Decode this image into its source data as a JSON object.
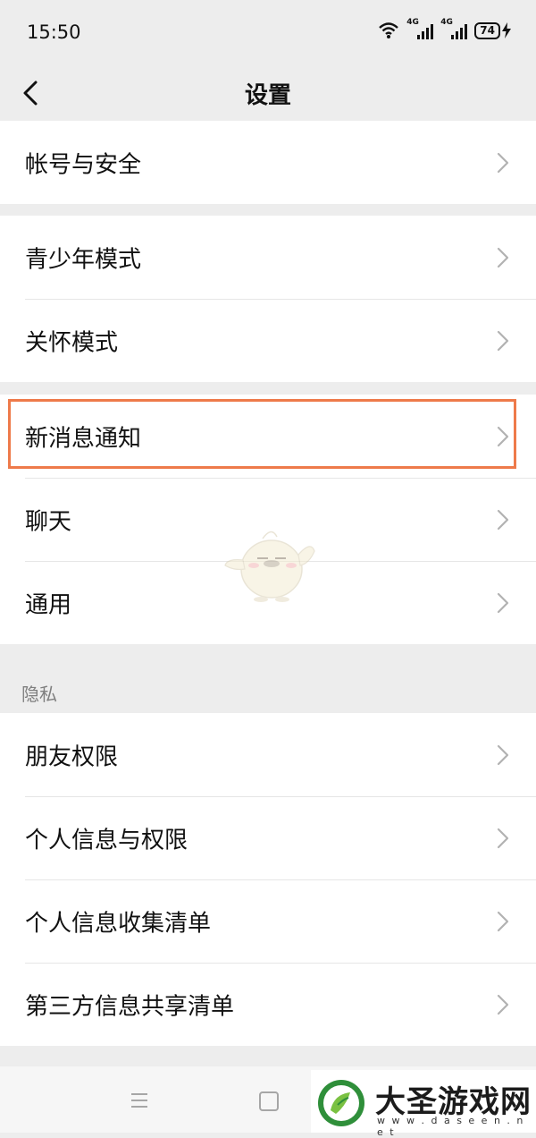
{
  "status_bar": {
    "time": "15:50",
    "signal_1_tag": "4G",
    "signal_2_tag": "4G",
    "battery_level": "74"
  },
  "header": {
    "title": "设置"
  },
  "groups": [
    {
      "items": [
        {
          "label": "帐号与安全"
        }
      ]
    },
    {
      "items": [
        {
          "label": "青少年模式"
        },
        {
          "label": "关怀模式"
        }
      ]
    },
    {
      "items": [
        {
          "label": "新消息通知",
          "highlighted": true
        },
        {
          "label": "聊天"
        },
        {
          "label": "通用"
        }
      ]
    }
  ],
  "privacy": {
    "section_label": "隐私",
    "items": [
      {
        "label": "朋友权限"
      },
      {
        "label": "个人信息与权限"
      },
      {
        "label": "个人信息收集清单"
      },
      {
        "label": "第三方信息共享清单"
      }
    ]
  },
  "watermark": {
    "title": "大圣游戏网",
    "url": "w w w . d a s e e n . n e t"
  },
  "colors": {
    "highlight": "#ee7a4a",
    "background": "#ededed",
    "row_background": "#ffffff",
    "chevron": "#b2b2b2",
    "section_text": "#7f7f7f"
  },
  "icons": {
    "back": "chevron-left-icon",
    "row_arrow": "chevron-right-icon",
    "wifi": "wifi-icon",
    "charging": "lightning-icon",
    "nav_menu": "menu-icon",
    "nav_home": "square-home-icon"
  }
}
